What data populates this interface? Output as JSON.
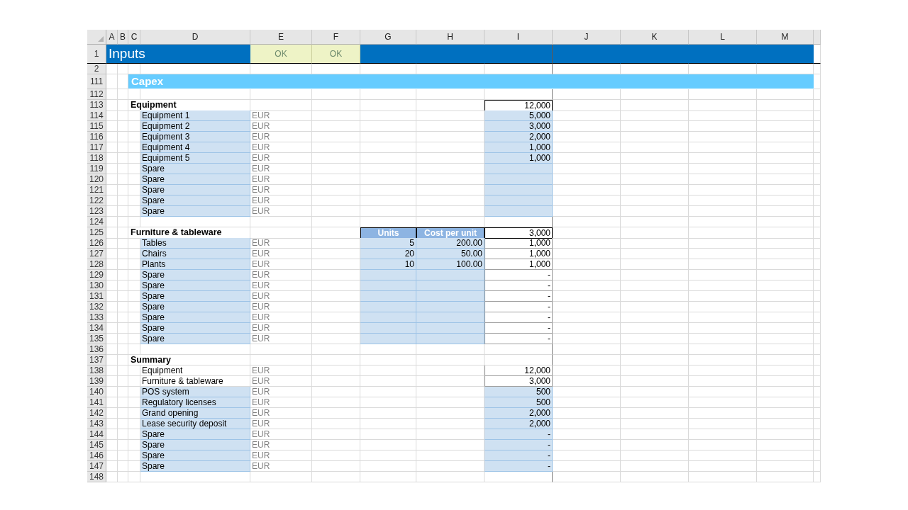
{
  "columns": [
    "A",
    "B",
    "C",
    "D",
    "E",
    "F",
    "G",
    "H",
    "I",
    "J",
    "K",
    "L",
    "M"
  ],
  "rows": [
    {
      "row": "1",
      "kind": "title",
      "label": "Inputs",
      "checks": [
        "OK",
        "OK"
      ]
    },
    {
      "row": "2",
      "kind": "blank"
    },
    {
      "row": "111",
      "kind": "section",
      "label": "Capex"
    },
    {
      "row": "112",
      "kind": "blank"
    },
    {
      "row": "113",
      "kind": "group",
      "label": "Equipment",
      "total": "12,000"
    },
    {
      "row": "114",
      "kind": "item",
      "label": "Equipment 1",
      "unit": "EUR",
      "value": "5,000",
      "label_input": true,
      "units_input": false,
      "value_input": true
    },
    {
      "row": "115",
      "kind": "item",
      "label": "Equipment 2",
      "unit": "EUR",
      "value": "3,000",
      "label_input": true,
      "units_input": false,
      "value_input": true
    },
    {
      "row": "116",
      "kind": "item",
      "label": "Equipment 3",
      "unit": "EUR",
      "value": "2,000",
      "label_input": true,
      "units_input": false,
      "value_input": true
    },
    {
      "row": "117",
      "kind": "item",
      "label": "Equipment 4",
      "unit": "EUR",
      "value": "1,000",
      "label_input": true,
      "units_input": false,
      "value_input": true
    },
    {
      "row": "118",
      "kind": "item",
      "label": "Equipment 5",
      "unit": "EUR",
      "value": "1,000",
      "label_input": true,
      "units_input": false,
      "value_input": true
    },
    {
      "row": "119",
      "kind": "item",
      "label": "Spare",
      "unit": "EUR",
      "label_input": true,
      "units_input": false,
      "value_input": true
    },
    {
      "row": "120",
      "kind": "item",
      "label": "Spare",
      "unit": "EUR",
      "label_input": true,
      "units_input": false,
      "value_input": true
    },
    {
      "row": "121",
      "kind": "item",
      "label": "Spare",
      "unit": "EUR",
      "label_input": true,
      "units_input": false,
      "value_input": true
    },
    {
      "row": "122",
      "kind": "item",
      "label": "Spare",
      "unit": "EUR",
      "label_input": true,
      "units_input": false,
      "value_input": true
    },
    {
      "row": "123",
      "kind": "item",
      "label": "Spare",
      "unit": "EUR",
      "label_input": true,
      "units_input": false,
      "value_input": true
    },
    {
      "row": "124",
      "kind": "blank"
    },
    {
      "row": "125",
      "kind": "group",
      "label": "Furniture & tableware",
      "headers": [
        "Units",
        "Cost per unit"
      ],
      "total": "3,000"
    },
    {
      "row": "126",
      "kind": "item",
      "label": "Tables",
      "unit": "EUR",
      "units": "5",
      "cost": "200.00",
      "value": "1,000",
      "label_input": true,
      "units_input": true,
      "value_input": false
    },
    {
      "row": "127",
      "kind": "item",
      "label": "Chairs",
      "unit": "EUR",
      "units": "20",
      "cost": "50.00",
      "value": "1,000",
      "label_input": true,
      "units_input": true,
      "value_input": false
    },
    {
      "row": "128",
      "kind": "item",
      "label": "Plants",
      "unit": "EUR",
      "units": "10",
      "cost": "100.00",
      "value": "1,000",
      "label_input": true,
      "units_input": true,
      "value_input": false
    },
    {
      "row": "129",
      "kind": "item",
      "label": "Spare",
      "unit": "EUR",
      "value": "-",
      "label_input": true,
      "units_input": true,
      "value_input": false
    },
    {
      "row": "130",
      "kind": "item",
      "label": "Spare",
      "unit": "EUR",
      "value": "-",
      "label_input": true,
      "units_input": true,
      "value_input": false
    },
    {
      "row": "131",
      "kind": "item",
      "label": "Spare",
      "unit": "EUR",
      "value": "-",
      "label_input": true,
      "units_input": true,
      "value_input": false
    },
    {
      "row": "132",
      "kind": "item",
      "label": "Spare",
      "unit": "EUR",
      "value": "-",
      "label_input": true,
      "units_input": true,
      "value_input": false
    },
    {
      "row": "133",
      "kind": "item",
      "label": "Spare",
      "unit": "EUR",
      "value": "-",
      "label_input": true,
      "units_input": true,
      "value_input": false
    },
    {
      "row": "134",
      "kind": "item",
      "label": "Spare",
      "unit": "EUR",
      "value": "-",
      "label_input": true,
      "units_input": true,
      "value_input": false
    },
    {
      "row": "135",
      "kind": "item",
      "label": "Spare",
      "unit": "EUR",
      "value": "-",
      "label_input": true,
      "units_input": true,
      "value_input": false
    },
    {
      "row": "136",
      "kind": "blank"
    },
    {
      "row": "137",
      "kind": "group",
      "label": "Summary"
    },
    {
      "row": "138",
      "kind": "item",
      "label": "Equipment",
      "unit": "EUR",
      "value": "12,000",
      "label_input": false,
      "units_input": false,
      "value_input": false
    },
    {
      "row": "139",
      "kind": "item",
      "label": "Furniture & tableware",
      "unit": "EUR",
      "value": "3,000",
      "label_input": false,
      "units_input": false,
      "value_input": false
    },
    {
      "row": "140",
      "kind": "item",
      "label": "POS system",
      "unit": "EUR",
      "value": "500",
      "label_input": true,
      "units_input": false,
      "value_input": true
    },
    {
      "row": "141",
      "kind": "item",
      "label": "Regulatory licenses",
      "unit": "EUR",
      "value": "500",
      "label_input": true,
      "units_input": false,
      "value_input": true
    },
    {
      "row": "142",
      "kind": "item",
      "label": "Grand opening",
      "unit": "EUR",
      "value": "2,000",
      "label_input": true,
      "units_input": false,
      "value_input": true
    },
    {
      "row": "143",
      "kind": "item",
      "label": "Lease security deposit",
      "unit": "EUR",
      "value": "2,000",
      "label_input": true,
      "units_input": false,
      "value_input": true
    },
    {
      "row": "144",
      "kind": "item",
      "label": "Spare",
      "unit": "EUR",
      "value": "-",
      "label_input": true,
      "units_input": false,
      "value_input": true
    },
    {
      "row": "145",
      "kind": "item",
      "label": "Spare",
      "unit": "EUR",
      "value": "-",
      "label_input": true,
      "units_input": false,
      "value_input": true
    },
    {
      "row": "146",
      "kind": "item",
      "label": "Spare",
      "unit": "EUR",
      "value": "-",
      "label_input": true,
      "units_input": false,
      "value_input": true
    },
    {
      "row": "147",
      "kind": "item",
      "label": "Spare",
      "unit": "EUR",
      "value": "-",
      "label_input": true,
      "units_input": false,
      "value_input": true
    },
    {
      "row": "148",
      "kind": "blank"
    }
  ]
}
